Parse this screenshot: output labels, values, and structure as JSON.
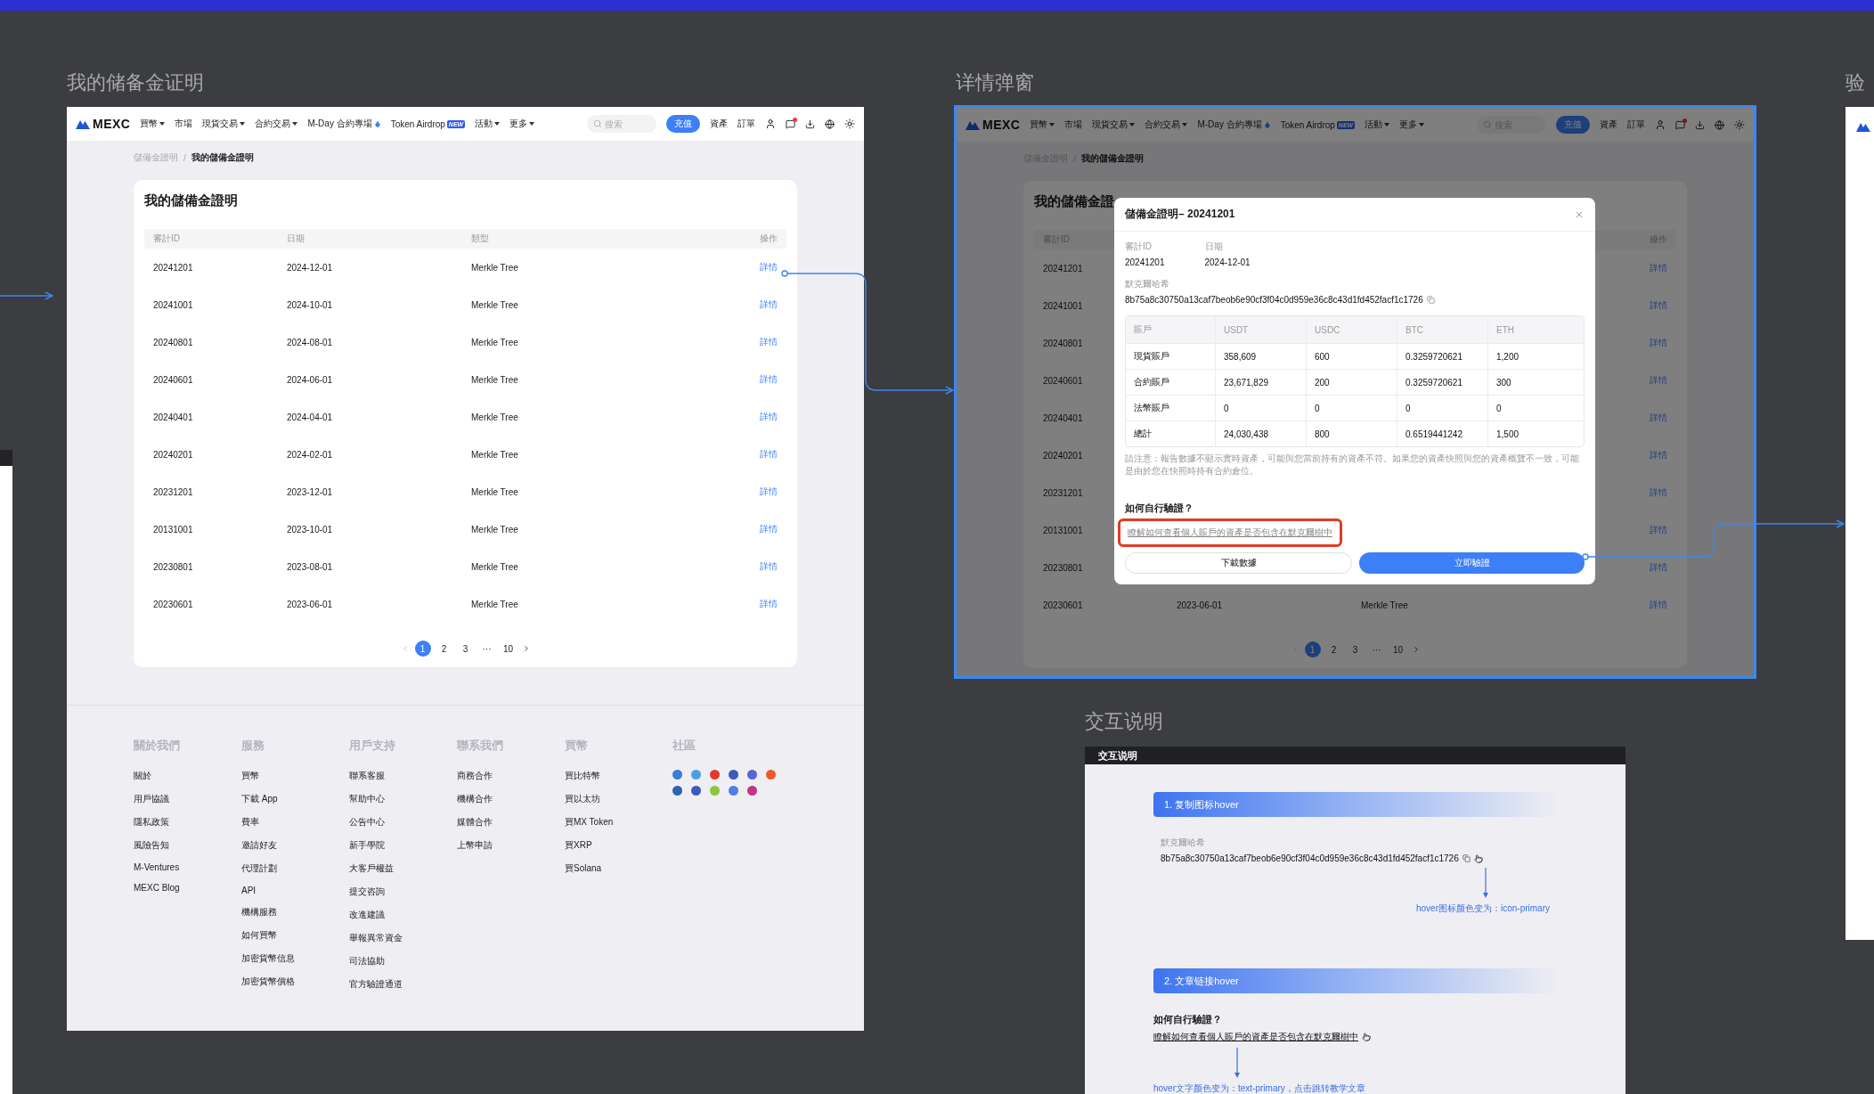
{
  "reserve_page": {
    "title": "我的储备金证明",
    "page": {
      "nav": {
        "logo": "MEXC",
        "items": [
          {
            "label": "買幣",
            "kind": "dropdown"
          },
          {
            "label": "市場",
            "kind": "plain"
          },
          {
            "label": "現貨交易",
            "kind": "dropdown"
          },
          {
            "label": "合約交易",
            "kind": "dropdown"
          },
          {
            "label": "M-Day 合約專場",
            "kind": "hot"
          },
          {
            "label": "Token Airdrop",
            "kind": "badge",
            "badge": "NEW"
          },
          {
            "label": "活動",
            "kind": "dropdown"
          },
          {
            "label": "更多",
            "kind": "dropdown"
          }
        ],
        "search": {
          "placeholder": "搜索"
        },
        "deposit": "充值",
        "links": [
          "資產",
          "訂單"
        ],
        "has_notification": true
      },
      "breadcrumb": [
        "儲備金證明",
        "我的儲備金證明"
      ],
      "breadcrumb_separator": "/",
      "card": {
        "title": "我的儲備金證明",
        "columns": {
          "id": "審計ID",
          "date": "日期",
          "type": "類型",
          "action": "操作"
        },
        "rows": [
          {
            "id": "20241201",
            "date": "2024-12-01",
            "type": "Merkle Tree",
            "action": "詳情"
          },
          {
            "id": "20241001",
            "date": "2024-10-01",
            "type": "Merkle Tree",
            "action": "詳情"
          },
          {
            "id": "20240801",
            "date": "2024-08-01",
            "type": "Merkle Tree",
            "action": "詳情"
          },
          {
            "id": "20240601",
            "date": "2024-06-01",
            "type": "Merkle Tree",
            "action": "詳情"
          },
          {
            "id": "20240401",
            "date": "2024-04-01",
            "type": "Merkle Tree",
            "action": "詳情"
          },
          {
            "id": "20240201",
            "date": "2024-02-01",
            "type": "Merkle Tree",
            "action": "詳情"
          },
          {
            "id": "20231201",
            "date": "2023-12-01",
            "type": "Merkle Tree",
            "action": "詳情"
          },
          {
            "id": "20131001",
            "date": "2023-10-01",
            "type": "Merkle Tree",
            "action": "詳情"
          },
          {
            "id": "20230801",
            "date": "2023-08-01",
            "type": "Merkle Tree",
            "action": "詳情"
          },
          {
            "id": "20230601",
            "date": "2023-06-01",
            "type": "Merkle Tree",
            "action": "詳情"
          }
        ],
        "pagination": [
          {
            "label": "1",
            "selected": true
          },
          {
            "label": "2",
            "selected": false
          },
          {
            "label": "3",
            "selected": false
          },
          {
            "label": "···",
            "selected": false
          },
          {
            "label": "10",
            "selected": false
          }
        ]
      },
      "footer": {
        "columns": [
          {
            "heading": "關於我們",
            "links": [
              "關於",
              "用戶協議",
              "隱私政策",
              "風險告知",
              "M-Ventures",
              "MEXC Blog"
            ]
          },
          {
            "heading": "服務",
            "links": [
              "買幣",
              "下載 App",
              "費率",
              "邀請好友",
              "代理計劃",
              "API",
              "機構服務",
              "如何買幣",
              "加密貨幣信息",
              "加密貨幣價格"
            ]
          },
          {
            "heading": "用戶支持",
            "links": [
              "聯系客服",
              "幫助中心",
              "公告中心",
              "新手學院",
              "大客戶權益",
              "提交咨詢",
              "改進建議",
              "舉報異常資金",
              "司法協助",
              "官方驗證通道"
            ]
          },
          {
            "heading": "聯系我們",
            "links": [
              "商務合作",
              "機構合作",
              "媒體合作",
              "上幣申請"
            ]
          },
          {
            "heading": "買幣",
            "links": [
              "買比特幣",
              "買以太坊",
              "買MX Token",
              "買XRP",
              "買Solana"
            ]
          }
        ],
        "community": {
          "heading": "社區"
        }
      }
    }
  },
  "detail_popup": {
    "title": "详情弹窗",
    "page": {
      "nav": {
        "logo": "MEXC",
        "items": [
          {
            "label": "買幣",
            "kind": "dropdown"
          },
          {
            "label": "市場",
            "kind": "plain"
          },
          {
            "label": "現貨交易",
            "kind": "dropdown"
          },
          {
            "label": "合約交易",
            "kind": "dropdown"
          },
          {
            "label": "M-Day 合約專場",
            "kind": "hot"
          },
          {
            "label": "Token Airdrop",
            "kind": "badge",
            "badge": "NEW"
          },
          {
            "label": "活動",
            "kind": "dropdown"
          },
          {
            "label": "更多",
            "kind": "dropdown"
          }
        ],
        "search": {
          "placeholder": "搜索"
        },
        "deposit": "充值",
        "links": [
          "資產",
          "訂單"
        ],
        "has_notification": true
      },
      "breadcrumb": [
        "儲備金證明",
        "我的儲備金證明"
      ],
      "breadcrumb_separator": "/",
      "card": {
        "title": "我的儲備金證",
        "columns": {
          "id": "審計ID",
          "action": "操作"
        },
        "rows": [
          {
            "id": "20241201",
            "action": "詳情"
          },
          {
            "id": "20241001",
            "action": "詳情"
          },
          {
            "id": "20240801",
            "action": "詳情"
          },
          {
            "id": "20240601",
            "action": "詳情"
          },
          {
            "id": "20240401",
            "action": "詳情"
          },
          {
            "id": "20240201",
            "action": "詳情"
          },
          {
            "id": "20231201",
            "action": "詳情"
          },
          {
            "id": "20131001",
            "action": "詳情"
          },
          {
            "id": "20230801",
            "action": "詳情"
          },
          {
            "id": "20230601",
            "date": "2023-06-01",
            "type": "Merkle Tree",
            "action": "詳情"
          }
        ],
        "pagination": [
          {
            "label": "1",
            "selected": true
          },
          {
            "label": "2",
            "selected": false
          },
          {
            "label": "3",
            "selected": false
          },
          {
            "label": "···",
            "selected": false
          },
          {
            "label": "10",
            "selected": false
          }
        ]
      }
    },
    "modal": {
      "title": "儲備金證明– 20241201",
      "fields": [
        {
          "label": "審計ID",
          "value": "20241201"
        },
        {
          "label": "日期",
          "value": "2024-12-01"
        }
      ],
      "hash": {
        "label": "默克爾哈希",
        "value": "8b75a8c30750a13caf7beob6e90cf3f04c0d959e36c8c43d1fd452facf1c1726"
      },
      "table": {
        "columns": [
          "賬戶",
          "USDT",
          "USDC",
          "BTC",
          "ETH"
        ],
        "rows": [
          [
            "現貨賬戶",
            "358,609",
            "600",
            "0.3259720621",
            "1,200"
          ],
          [
            "合約賬戶",
            "23,671,829",
            "200",
            "0.3259720621",
            "300"
          ],
          [
            "法幣賬戶",
            "0",
            "0",
            "0",
            "0"
          ],
          [
            "總計",
            "24,030,438",
            "800",
            "0.6519441242",
            "1,500"
          ]
        ]
      },
      "note": "請注意：報告數據不顯示實時資產，可能與您當前持有的資產不符。如果您的資產快照與您的資產概覽不一致，可能是由於您在快照時持有合約倉位。",
      "verify": {
        "heading": "如何自行驗證？",
        "link": "瞭解如何查看個人賬戶的資產是否包含在默克爾樹中",
        "highlighted": true
      },
      "buttons": [
        {
          "label": "下載數據",
          "kind": "secondary"
        },
        {
          "label": "立即驗證",
          "kind": "primary"
        }
      ]
    }
  },
  "interaction_notes": {
    "title": "交互说明",
    "panel_title": "交互说明",
    "sections": [
      {
        "heading": "1. 复制图标hover",
        "kind": "copy",
        "label": "默克爾哈希",
        "value": "8b75a8c30750a13caf7beob6e90cf3f04c0d959e36c8c43d1fd452facf1c1726",
        "note": "hover图标颜色变为：icon-primary"
      },
      {
        "heading": "2. 文章链接hover",
        "kind": "link",
        "label": "如何自行驗證？",
        "value": "瞭解如何查看個人賬戶的資產是否包含在默克爾樹中",
        "note": "hover文字颜色变为：text-primary，点击跳转教学文章"
      }
    ]
  },
  "edge_frame": {
    "title": "验"
  }
}
